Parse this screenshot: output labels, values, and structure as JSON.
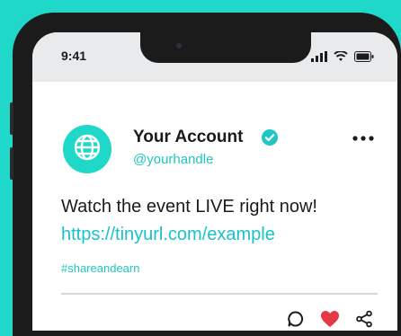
{
  "status_bar": {
    "time": "9:41",
    "icons": [
      "cellular-signal-icon",
      "wifi-icon",
      "battery-icon"
    ]
  },
  "post": {
    "account_name": "Your Account",
    "handle": "@yourhandle",
    "verified": true,
    "text": "Watch the event LIVE right now!",
    "link": "https://tinyurl.com/example",
    "hashtag": "#shareandearn"
  },
  "actions": [
    {
      "name": "comment-icon"
    },
    {
      "name": "heart-icon"
    },
    {
      "name": "share-icon"
    }
  ],
  "colors": {
    "background": "#1fd8c9",
    "accent": "#1fc6c2",
    "heart": "#e63946",
    "text": "#1b1b1b"
  }
}
